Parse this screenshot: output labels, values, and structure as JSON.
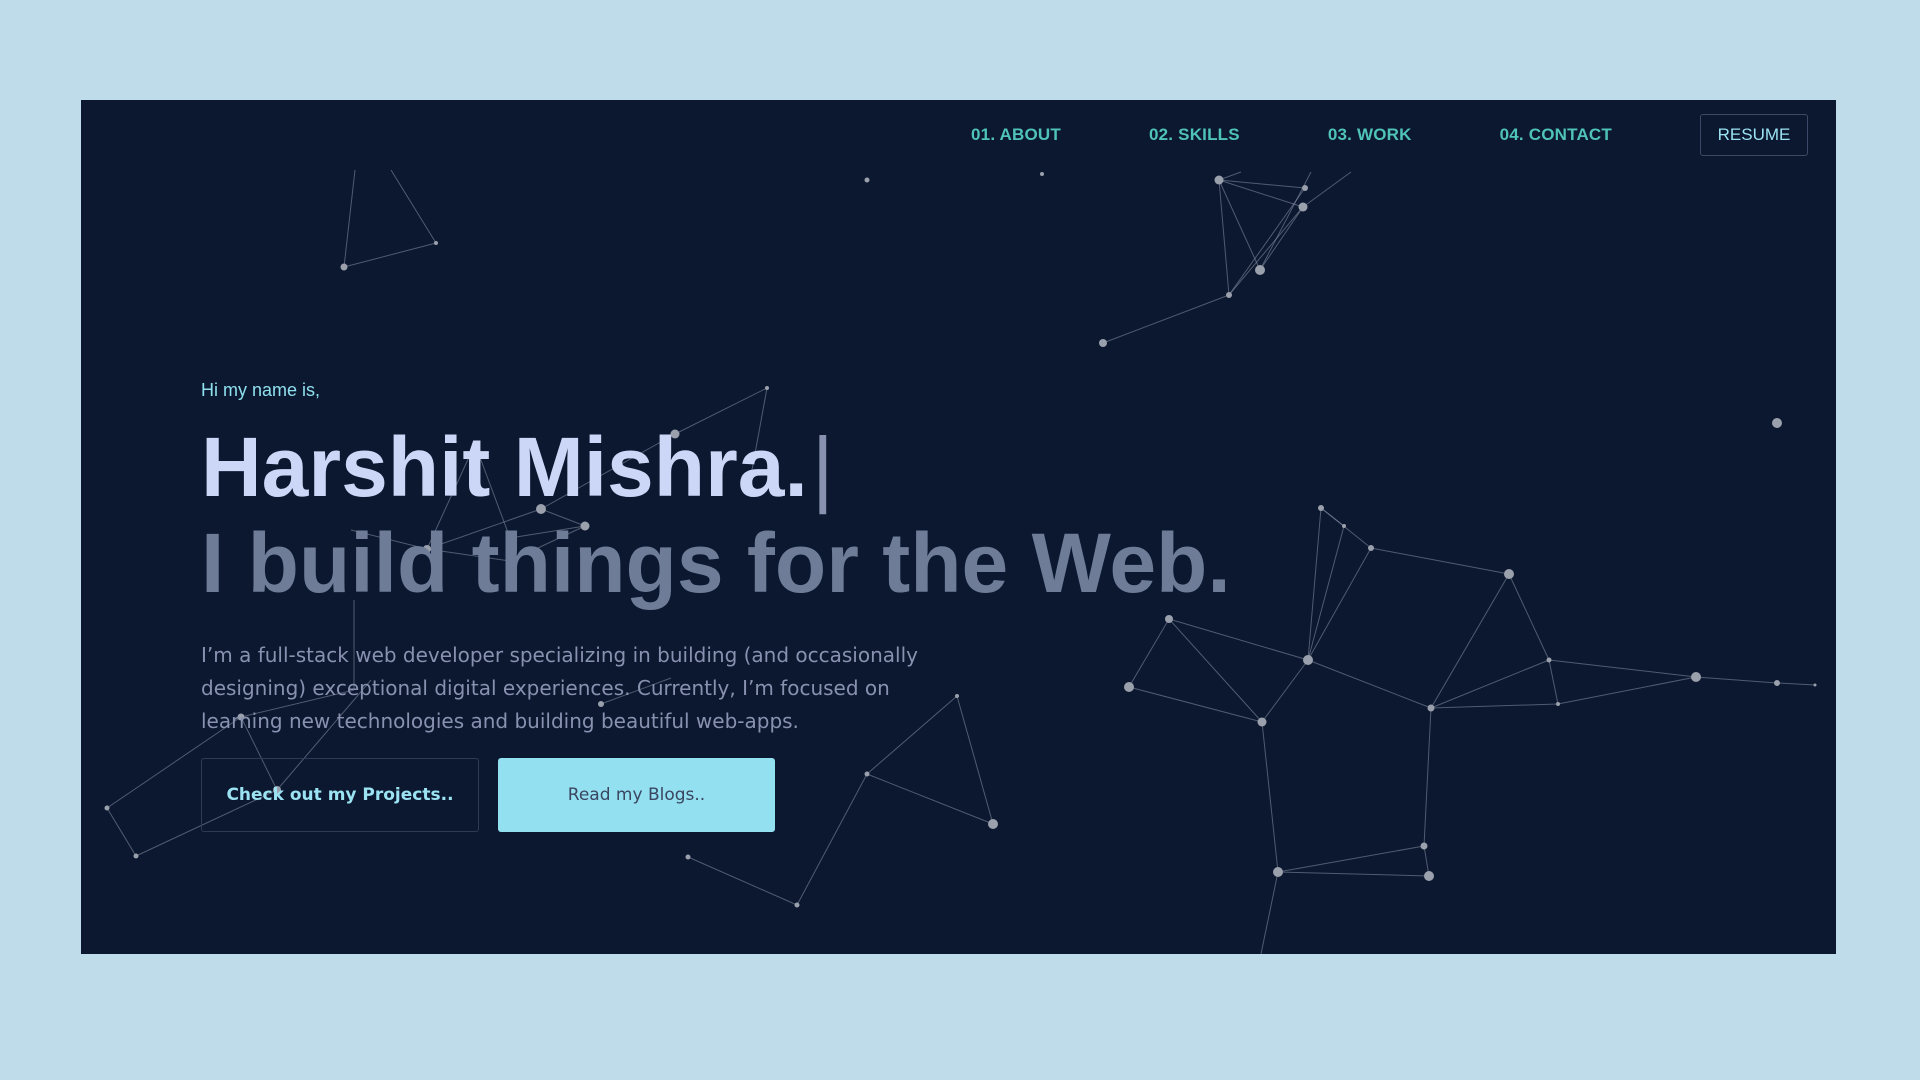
{
  "nav": {
    "items": [
      {
        "label": "01. ABOUT"
      },
      {
        "label": "02. SKILLS"
      },
      {
        "label": "03. WORK"
      },
      {
        "label": "04. CONTACT"
      }
    ],
    "resume_label": "RESUME"
  },
  "hero": {
    "greeting": "Hi my name is,",
    "name": "Harshit Mishra.",
    "cursor": "|",
    "tagline": "I build things for the Web.",
    "bio": "I’m a full-stack web developer specializing in building (and occasionally designing) exceptional digital experiences. Currently, I’m focused on learning new technologies and building beautiful web-apps.",
    "primary_button": "Check out my Projects..",
    "secondary_button": "Read my Blogs.."
  },
  "colors": {
    "background": "#0b1830",
    "page": "#bfdcea",
    "accent": "#4fc3b8",
    "accent_light": "#93e0f0",
    "name": "#ccd6f6",
    "muted": "#8892b0"
  }
}
